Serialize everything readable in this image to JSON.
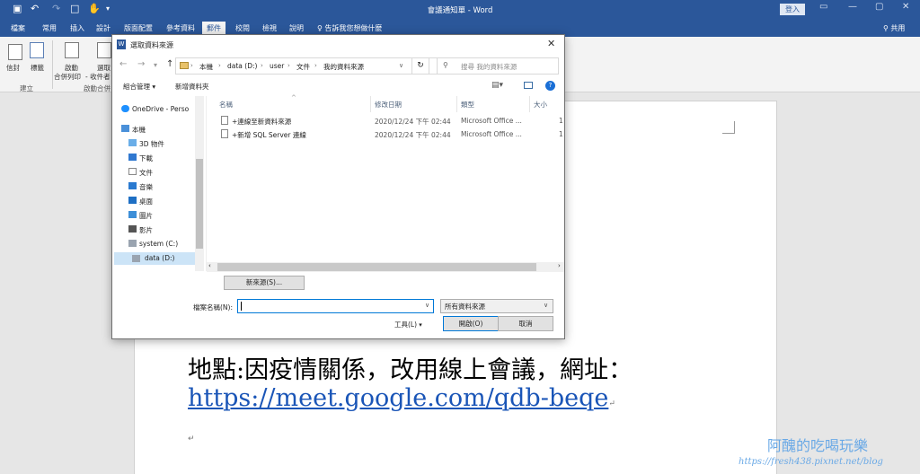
{
  "titlebar": {
    "doc_title": "會議通知單 - Word",
    "login": "登入"
  },
  "tabs": [
    "檔案",
    "常用",
    "插入",
    "設計",
    "版面配置",
    "參考資料",
    "郵件",
    "校閱",
    "檢視",
    "說明"
  ],
  "active_tab": "郵件",
  "tell_me": "告訴我您想做什麼",
  "share": "共用",
  "ribbon": {
    "envelopes": "信封",
    "labels": "標籤",
    "group_create": "建立",
    "start_merge": "啟動",
    "start_merge_2": "合併列印",
    "select_recipients": "選取",
    "select_recipients_2": "- 收件者",
    "group_start": "啟動合併"
  },
  "document": {
    "location_line": "地點:因疫情關係，改用線上會議，網址：",
    "url": "https://meet.google.com/qdb-beqe",
    "para_mark": "↵"
  },
  "watermark": {
    "name": "阿醜的吃喝玩樂",
    "url": "https://fresh438.pixnet.net/blog"
  },
  "dialog": {
    "title": "選取資料來源",
    "path": [
      "本機",
      "data (D:)",
      "user",
      "文件",
      "我的資料來源"
    ],
    "search_placeholder": "搜尋 我的資料來源",
    "organize": "組合管理 ▾",
    "new_folder": "新增資料夾",
    "tree": [
      {
        "label": "OneDrive - Perso",
        "icon": "cloud-icon"
      },
      {
        "label": "本機",
        "icon": "computer-icon"
      },
      {
        "label": "3D 物件",
        "icon": "cube-icon"
      },
      {
        "label": "下載",
        "icon": "download-icon"
      },
      {
        "label": "文件",
        "icon": "document-icon"
      },
      {
        "label": "音樂",
        "icon": "music-icon"
      },
      {
        "label": "桌面",
        "icon": "desktop-icon"
      },
      {
        "label": "圖片",
        "icon": "picture-icon"
      },
      {
        "label": "影片",
        "icon": "video-icon"
      },
      {
        "label": "system (C:)",
        "icon": "drive-icon"
      },
      {
        "label": "data (D:)",
        "icon": "drive-icon"
      }
    ],
    "columns": {
      "name": "名稱",
      "date": "修改日期",
      "type": "類型",
      "size": "大小"
    },
    "files": [
      {
        "name": "+連線至新資料來源",
        "date": "2020/12/24 下午 02:44",
        "type": "Microsoft Office ...",
        "size": "1"
      },
      {
        "name": "+新增 SQL Server 連線",
        "date": "2020/12/24 下午 02:44",
        "type": "Microsoft Office ...",
        "size": "1"
      }
    ],
    "new_source": "新來源(S)...",
    "filename_label": "檔案名稱(N):",
    "filename_value": "",
    "filetype": "所有資料來源",
    "tools": "工具(L)",
    "open": "開啟(O)",
    "cancel": "取消"
  },
  "colors": {
    "word_blue": "#2b579a",
    "accent": "#0078d7",
    "link": "#1a55b7"
  }
}
